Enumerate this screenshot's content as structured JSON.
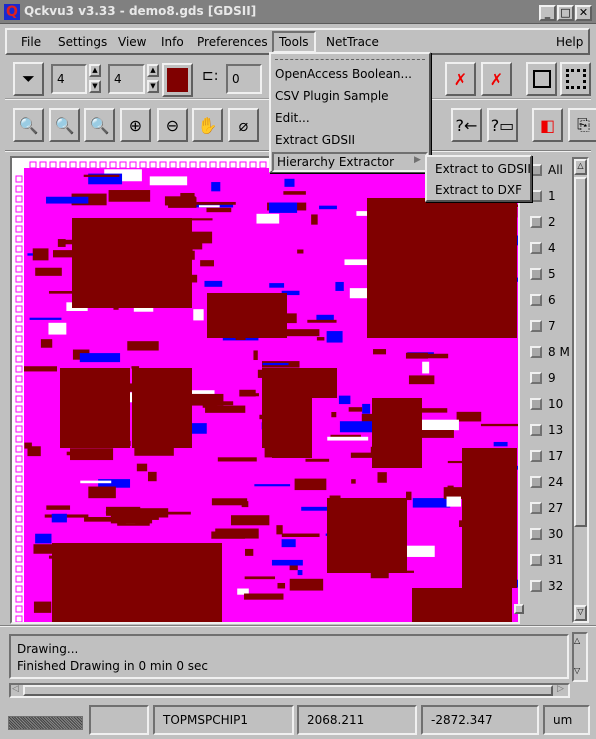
{
  "window": {
    "title": "Qckvu3 v3.33 - demo8.gds [GDSII]",
    "app_icon": "Q"
  },
  "menubar": {
    "items": [
      {
        "label": "File",
        "u": "F"
      },
      {
        "label": "Settings",
        "u": "S"
      },
      {
        "label": "View",
        "u": "V"
      },
      {
        "label": "Info",
        "u": "I"
      },
      {
        "label": "Preferences",
        "u": "P"
      },
      {
        "label": "Tools",
        "u": "T"
      },
      {
        "label": "NetTrace",
        "u": ""
      }
    ],
    "help": "Help"
  },
  "toolbar": {
    "level_min": "4",
    "level_max": "4",
    "hierarchy_depth": "0",
    "fill_color": "#800000"
  },
  "tools_menu": {
    "items": [
      "OpenAccess Boolean...",
      "CSV Plugin Sample",
      "Edit...",
      "Extract GDSII",
      "Hierarchy Extractor"
    ]
  },
  "hierarchy_submenu": {
    "items": [
      "Extract to GDSII",
      "Extract to DXF"
    ]
  },
  "layers": [
    "All",
    "1",
    "2",
    "4",
    "5",
    "6",
    "7",
    "8 M",
    "9",
    "10",
    "13",
    "17",
    "24",
    "27",
    "30",
    "31",
    "32"
  ],
  "messages": [
    "Drawing...",
    "Finished Drawing in 0 min 0 sec"
  ],
  "statusbar": {
    "cell": "TOPMSPCHIP1",
    "x": "2068.211",
    "y": "-2872.347",
    "units": "um"
  },
  "colors": {
    "layout_bg": "#800000",
    "metal": "#ff00ff",
    "poly": "#0000ff",
    "chrome": "#c0c0c0"
  }
}
